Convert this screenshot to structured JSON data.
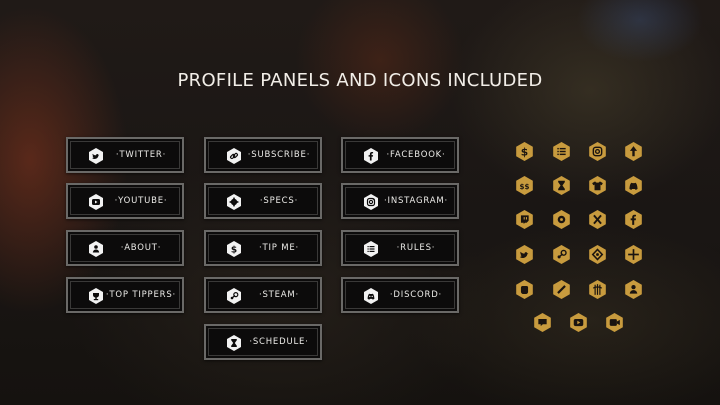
{
  "title": "PROFILE PANELS AND ICONS INCLUDED",
  "colors": {
    "gold": "#c89b3e",
    "panel_bg": "#0c0b0b",
    "panel_border": "#6a6967",
    "text": "#ecebe8"
  },
  "panels": [
    {
      "label": "·TWITTER·",
      "icon": "twitter-icon"
    },
    {
      "label": "·YOUTUBE·",
      "icon": "youtube-icon"
    },
    {
      "label": "·ABOUT·",
      "icon": "about-icon"
    },
    {
      "label": "·TOP TIPPERS·",
      "icon": "top-tippers-icon"
    },
    {
      "label": "·SUBSCRIBE·",
      "icon": "link-icon"
    },
    {
      "label": "·SPECS·",
      "icon": "gear-icon"
    },
    {
      "label": "·TIP ME·",
      "icon": "dollar-icon"
    },
    {
      "label": "·STEAM·",
      "icon": "steam-icon"
    },
    {
      "label": "·SCHEDULE·",
      "icon": "hourglass-icon"
    },
    {
      "label": "·FACEBOOK·",
      "icon": "facebook-icon"
    },
    {
      "label": "·INSTAGRAM·",
      "icon": "instagram-icon"
    },
    {
      "label": "·RULES·",
      "icon": "list-icon"
    },
    {
      "label": "·DISCORD·",
      "icon": "discord-icon"
    }
  ],
  "icon_grid": [
    "dollar-icon",
    "list-icon",
    "instagram-icon",
    "up-arrow-icon",
    "money-icon",
    "hourglass-icon",
    "tshirt-icon",
    "discord-icon",
    "twitch-icon",
    "gear-icon",
    "xbox-icon",
    "facebook-icon",
    "twitter-icon",
    "steam-icon",
    "target-icon",
    "crosshair-icon",
    "fist-icon",
    "link-icon",
    "spears-icon",
    "about-icon",
    "chat-icon",
    "youtube-icon",
    "video-icon"
  ]
}
